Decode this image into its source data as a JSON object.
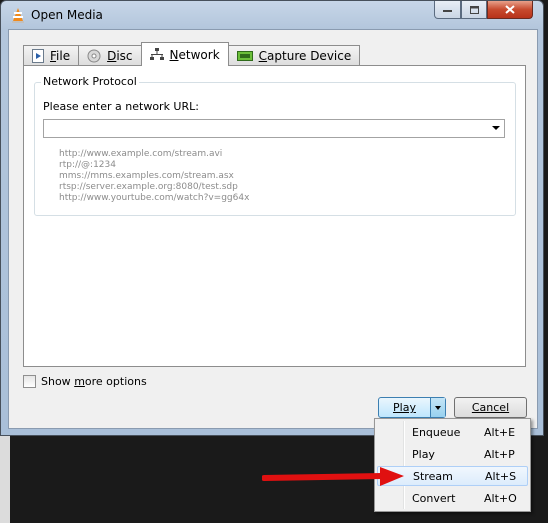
{
  "window": {
    "title": "Open Media"
  },
  "tabs": [
    {
      "label_pre": "",
      "label_ul": "F",
      "label_post": "ile",
      "icon": "play-file-icon"
    },
    {
      "label_pre": "",
      "label_ul": "D",
      "label_post": "isc",
      "icon": "disc-icon"
    },
    {
      "label_pre": "",
      "label_ul": "N",
      "label_post": "etwork",
      "icon": "network-icon"
    },
    {
      "label_pre": "",
      "label_ul": "C",
      "label_post": "apture Device",
      "icon": "capture-device-icon"
    }
  ],
  "network": {
    "group_title": "Network Protocol",
    "url_label": "Please enter a network URL:",
    "url_value": "",
    "examples": [
      "http://www.example.com/stream.avi",
      "rtp://@:1234",
      "mms://mms.examples.com/stream.asx",
      "rtsp://server.example.org:8080/test.sdp",
      "http://www.yourtube.com/watch?v=gg64x"
    ]
  },
  "options": {
    "show_more_pre": "Show ",
    "show_more_ul": "m",
    "show_more_post": "ore options",
    "checked": false
  },
  "buttons": {
    "play": "Play",
    "cancel": "Cancel"
  },
  "menu": [
    {
      "label": "Enqueue",
      "accel": "Alt+E",
      "highlighted": false
    },
    {
      "label": "Play",
      "accel": "Alt+P",
      "highlighted": false
    },
    {
      "label": "Stream",
      "accel": "Alt+S",
      "highlighted": true
    },
    {
      "label": "Convert",
      "accel": "Alt+O",
      "highlighted": false
    }
  ],
  "colors": {
    "annotation_arrow": "#e01010",
    "accent": "#3c7fb1"
  }
}
